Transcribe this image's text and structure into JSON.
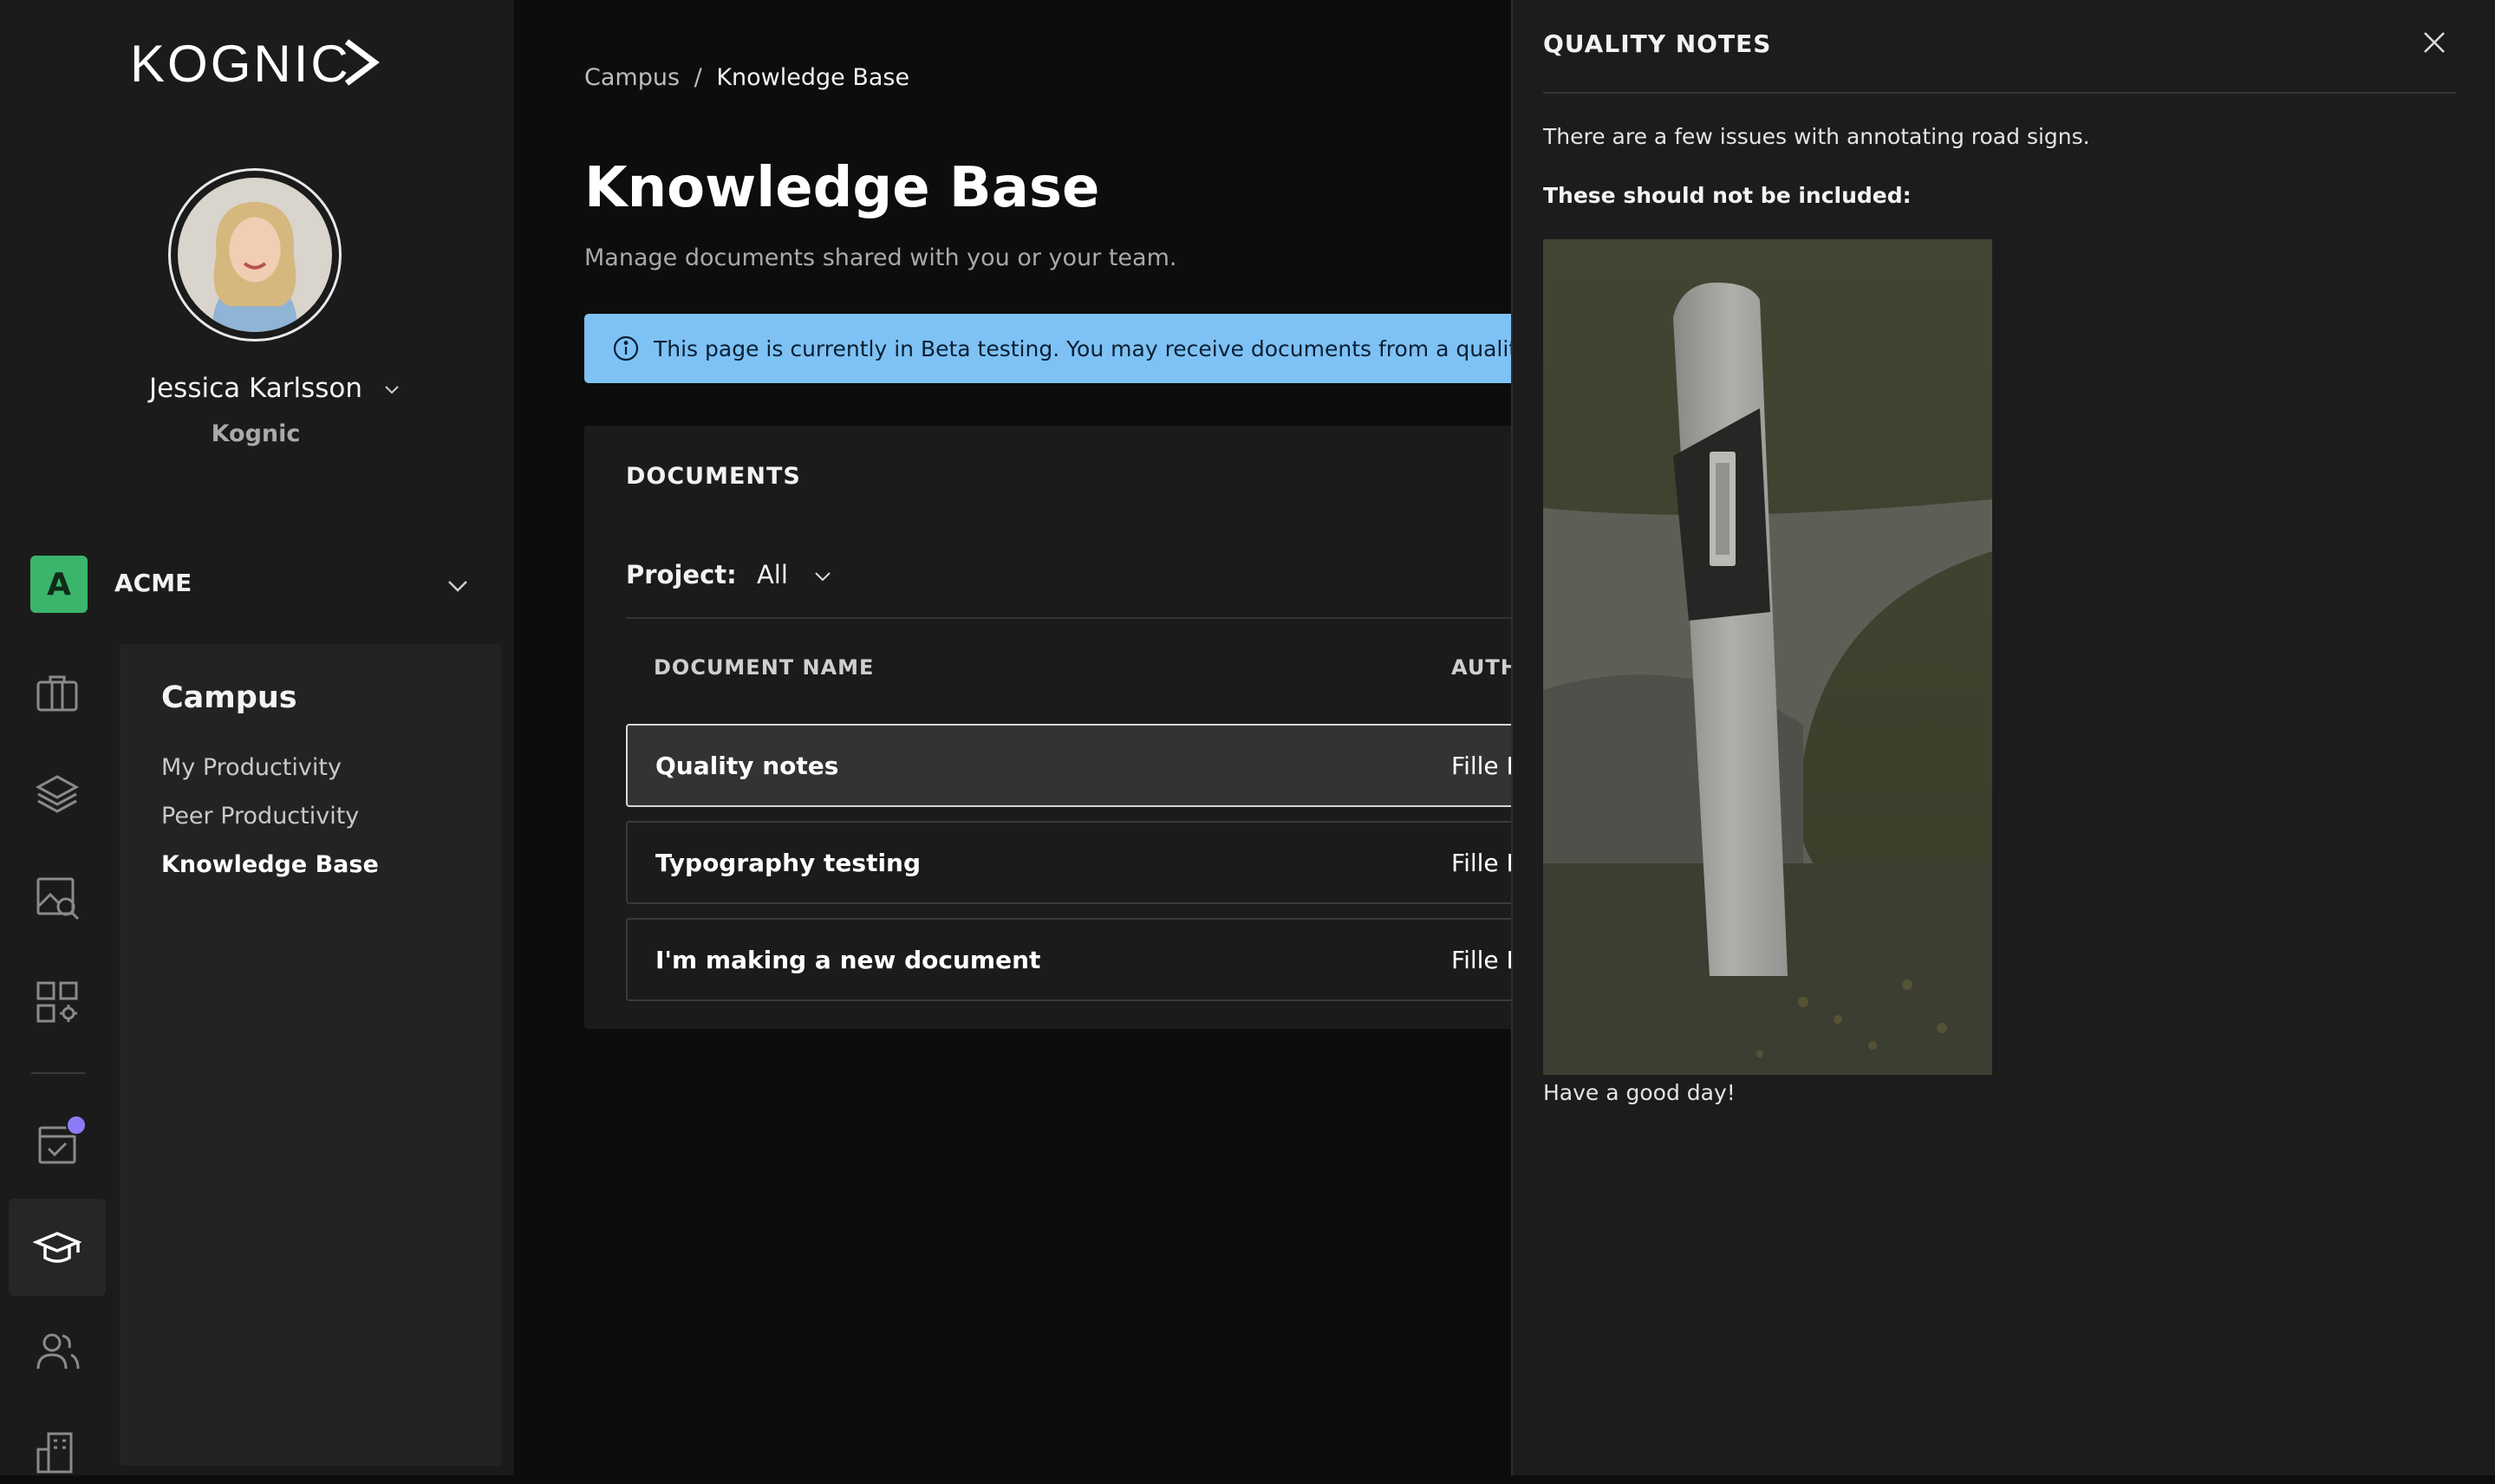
{
  "brand": {
    "logo_text": "KOGNIC"
  },
  "user": {
    "name": "Jessica Karlsson",
    "org": "Kognic"
  },
  "workspace": {
    "badge": "A",
    "name": "ACME",
    "badge_color": "#3bb56c"
  },
  "rail_icons": [
    "briefcase-icon",
    "layers-icon",
    "image-search-icon",
    "apps-settings-icon",
    "task-calendar-icon",
    "graduation-cap-icon",
    "users-icon",
    "building-settings-icon"
  ],
  "subnav": {
    "title": "Campus",
    "items": [
      {
        "label": "My Productivity"
      },
      {
        "label": "Peer Productivity"
      },
      {
        "label": "Knowledge Base",
        "active": true
      }
    ]
  },
  "breadcrumb": {
    "parent": "Campus",
    "separator": "/",
    "current": "Knowledge Base"
  },
  "page": {
    "title": "Knowledge Base",
    "subtitle": "Manage documents shared with you or your team.",
    "banner": "This page is currently in Beta testing. You may receive documents from a quality ma"
  },
  "documents": {
    "heading": "DOCUMENTS",
    "filter_label": "Project:",
    "filter_value": "All",
    "columns": [
      "DOCUMENT NAME",
      "AUTH"
    ],
    "rows": [
      {
        "name": "Quality notes",
        "author": "Fille D",
        "selected": true
      },
      {
        "name": "Typography testing",
        "author": "Fille D"
      },
      {
        "name": "I'm making a new document",
        "author": "Fille D"
      }
    ]
  },
  "drawer": {
    "title": "QUALITY NOTES",
    "p1": "There are a few issues with annotating road signs.",
    "p2": "These should not be included:",
    "footer": "Have a good day!"
  },
  "colors": {
    "accent_info": "#7ec2f5",
    "notification": "#8b7cf6",
    "background": "#0d0d0d",
    "panel": "#1b1b1b"
  }
}
